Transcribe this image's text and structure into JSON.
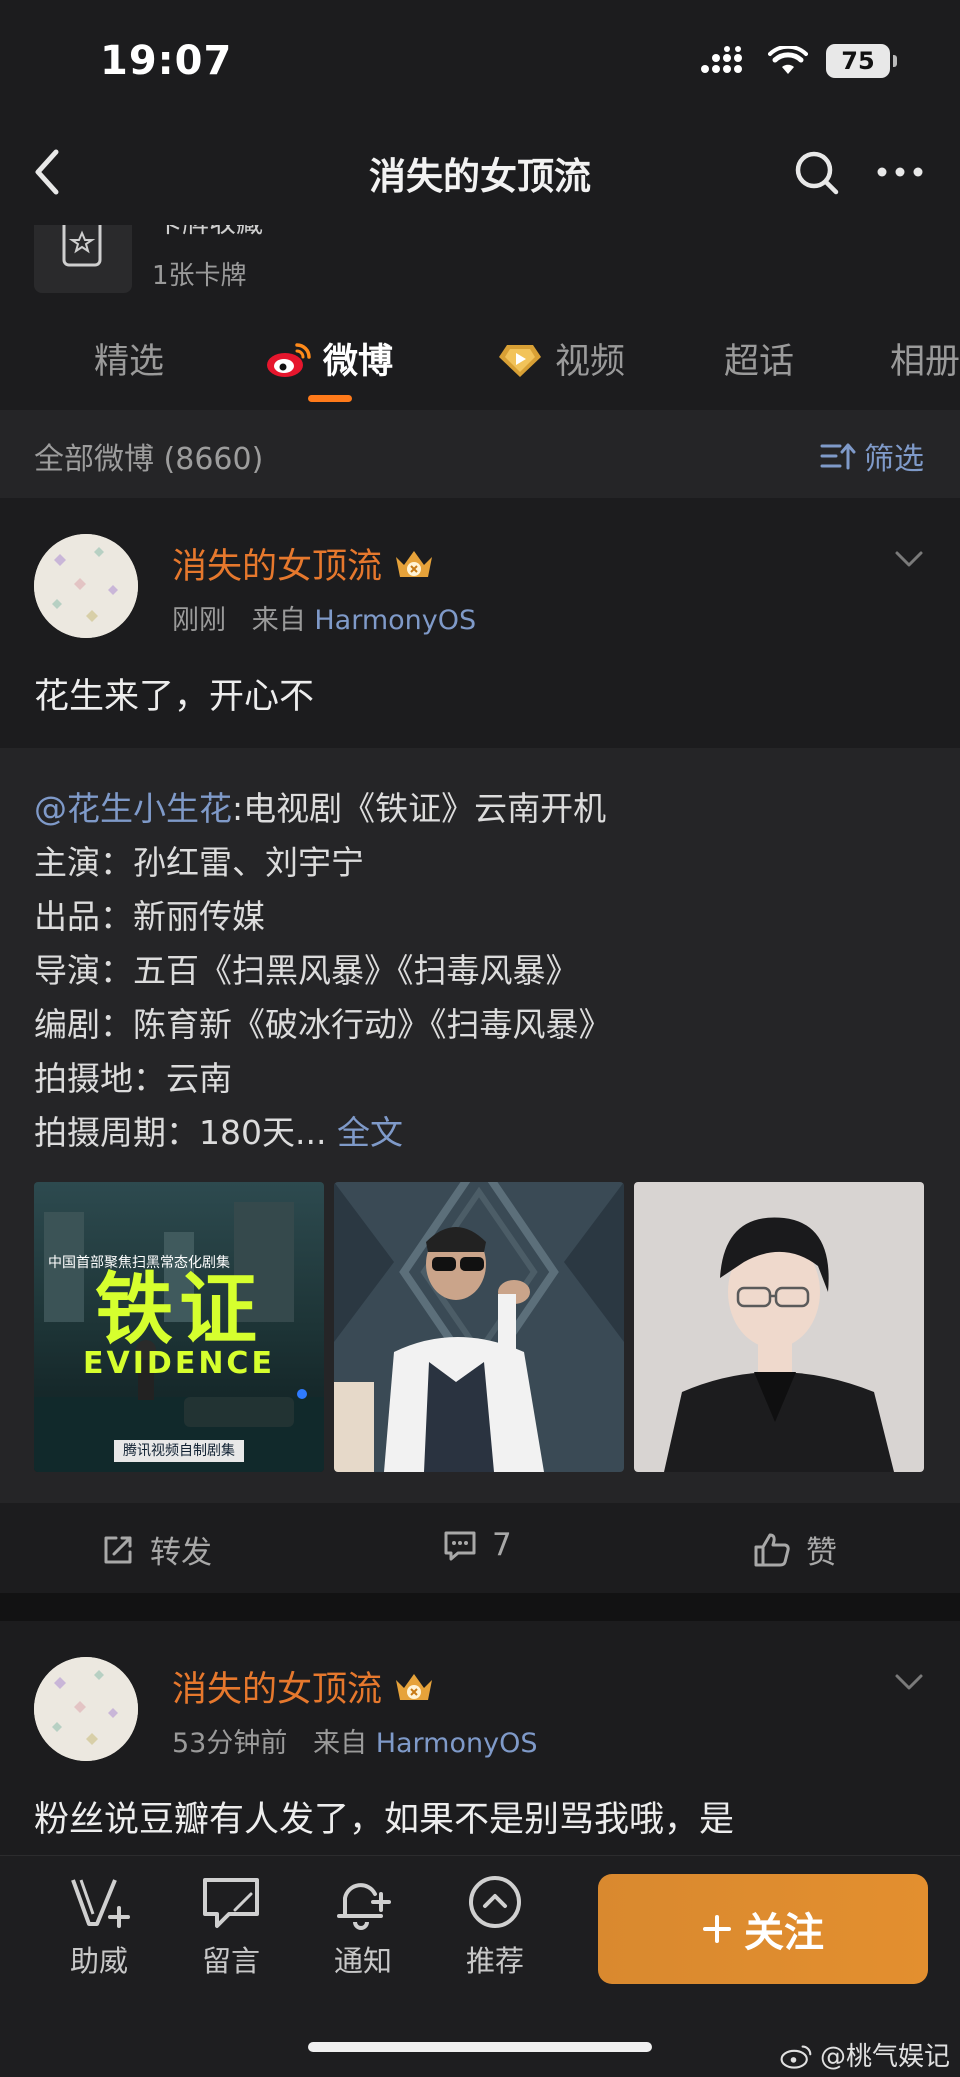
{
  "status_bar": {
    "time": "19:07",
    "battery": "75"
  },
  "nav": {
    "title": "消失的女顶流"
  },
  "card_collection": {
    "title": "卡牌收藏",
    "count": "1张卡牌"
  },
  "tabs": [
    {
      "label": "精选",
      "active": false
    },
    {
      "label": "微博",
      "active": true
    },
    {
      "label": "视频",
      "active": false
    },
    {
      "label": "超话",
      "active": false
    },
    {
      "label": "相册",
      "active": false
    }
  ],
  "filter": {
    "count_label": "全部微博 (8660)",
    "filter_label": "筛选"
  },
  "post1": {
    "author": "消失的女顶流",
    "time": "刚刚",
    "source_prefix": "来自",
    "source": "HarmonyOS",
    "text": "花生来了，开心不",
    "repost": {
      "mention": "@花生小生花",
      "line1_rest": ":电视剧《铁证》云南开机",
      "line2": "主演：孙红雷、刘宇宁",
      "line3": "出品：新丽传媒",
      "line4": "导演：五百《扫黑风暴》《扫毒风暴》",
      "line5": "编剧：陈育新《破冰行动》《扫毒风暴》",
      "line6": "拍摄地：云南",
      "line7_prefix": "拍摄周期：180天...",
      "more": "全文",
      "images": [
        {
          "caption_top": "中国首部聚焦扫黑常态化剧集",
          "title_cn": "铁证",
          "title_en": "EVIDENCE",
          "caption_bottom": "腾讯视频自制剧集"
        },
        {
          "alt": "man in sunglasses"
        },
        {
          "alt": "man in glasses"
        }
      ]
    },
    "actions": {
      "repost": "转发",
      "comment": "7",
      "like": "赞"
    }
  },
  "post2": {
    "author": "消失的女顶流",
    "time": "53分钟前",
    "source_prefix": "来自",
    "source": "HarmonyOS",
    "text": "粉丝说豆瓣有人发了，如果不是别骂我哦，是"
  },
  "bottom_bar": {
    "items": [
      {
        "label": "助威"
      },
      {
        "label": "留言"
      },
      {
        "label": "通知"
      },
      {
        "label": "推荐"
      }
    ],
    "follow": "关注"
  },
  "watermark": "@桃气娱记"
}
